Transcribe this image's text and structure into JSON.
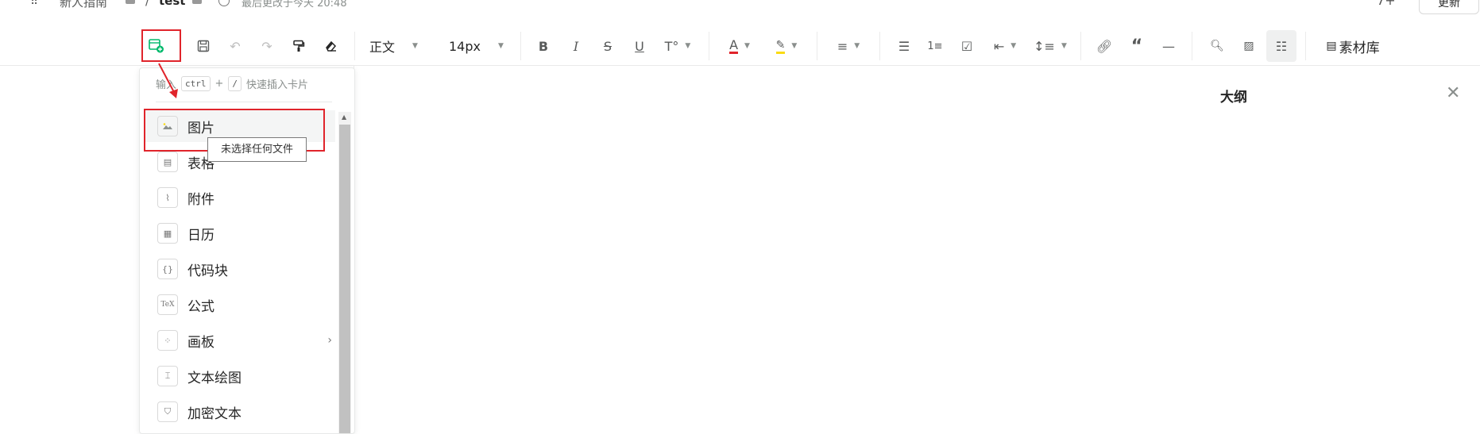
{
  "header": {
    "apps_icon": "grid-dots-icon",
    "breadcrumb_1": "新人指南",
    "breadcrumb_sep": "/",
    "breadcrumb_2": "test",
    "last_updated": "最后更改于今天 20:48",
    "share_label": "+",
    "update_button": "更新"
  },
  "toolbar": {
    "paragraph_style": "正文",
    "font_size": "14px",
    "material_library": "素材库",
    "icons": [
      "insert-card-icon",
      "save-icon",
      "undo-icon",
      "redo-icon",
      "format-painter-icon",
      "eraser-icon",
      "bold-icon",
      "italic-icon",
      "strikethrough-icon",
      "underline-icon",
      "text-style-icon",
      "font-color-icon",
      "highlight-icon",
      "align-icon",
      "bullet-list-icon",
      "ordered-list-icon",
      "task-list-icon",
      "indent-icon",
      "line-height-icon",
      "link-icon",
      "quote-icon",
      "divider-icon",
      "doc-search-icon",
      "image-insert-icon",
      "outline-toggle-icon",
      "library-icon"
    ]
  },
  "insert_panel": {
    "hint_prefix": "输入",
    "hint_key1": "ctrl",
    "hint_plus": "+",
    "hint_key2": "/",
    "hint_suffix": "快速插入卡片",
    "items": [
      {
        "label": "图片",
        "icon": "image-icon"
      },
      {
        "label": "表格",
        "icon": "table-icon"
      },
      {
        "label": "附件",
        "icon": "attachment-icon"
      },
      {
        "label": "日历",
        "icon": "calendar-icon"
      },
      {
        "label": "代码块",
        "icon": "code-block-icon"
      },
      {
        "label": "公式",
        "icon": "formula-icon"
      },
      {
        "label": "画板",
        "icon": "drawing-board-icon"
      },
      {
        "label": "文本绘图",
        "icon": "text-diagram-icon"
      },
      {
        "label": "加密文本",
        "icon": "encrypted-text-icon"
      }
    ],
    "tooltip": "未选择任何文件"
  },
  "outline": {
    "title": "大纲"
  },
  "colors": {
    "accent_red": "#e0242b",
    "font_color_underline": "#e0242b",
    "highlight_underline": "#fadb14",
    "insert_icon_green": "#00b96b"
  }
}
